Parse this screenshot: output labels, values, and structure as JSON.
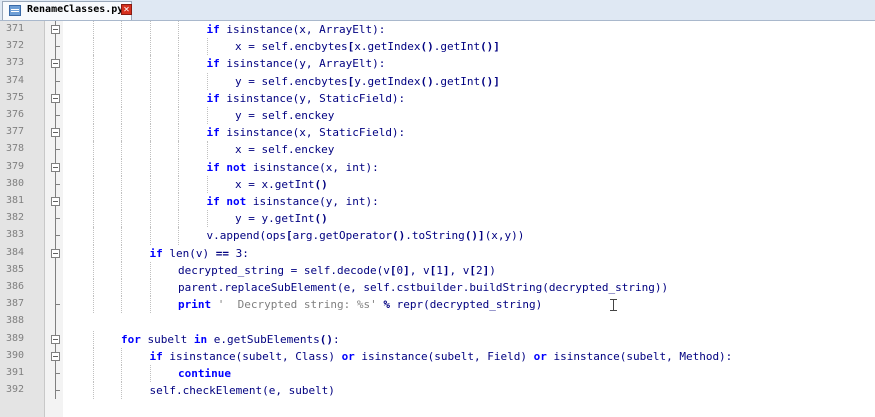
{
  "tab": {
    "title": "RenameClasses.py",
    "close_icon": "close-icon"
  },
  "lines": [
    {
      "num": "371",
      "fold": "open",
      "indent": 5,
      "code": "<k>if</k> isinstance(x, ArrayElt):"
    },
    {
      "num": "372",
      "fold": "end",
      "indent": 6,
      "code": "x = self.encbytes<b>[</b>x.getIndex<b>()</b>.getInt<b>()]</b>"
    },
    {
      "num": "373",
      "fold": "open",
      "indent": 5,
      "code": "<k>if</k> isinstance(y, ArrayElt):"
    },
    {
      "num": "374",
      "fold": "end",
      "indent": 6,
      "code": "y = self.encbytes<b>[</b>y.getIndex<b>()</b>.getInt<b>()]</b>"
    },
    {
      "num": "375",
      "fold": "open",
      "indent": 5,
      "code": "<k>if</k> isinstance(y, StaticField):"
    },
    {
      "num": "376",
      "fold": "end",
      "indent": 6,
      "code": "y = self.enckey"
    },
    {
      "num": "377",
      "fold": "open",
      "indent": 5,
      "code": "<k>if</k> isinstance(x, StaticField):"
    },
    {
      "num": "378",
      "fold": "end",
      "indent": 6,
      "code": "x = self.enckey"
    },
    {
      "num": "379",
      "fold": "open",
      "indent": 5,
      "code": "<k>if not</k> isinstance(x, int):"
    },
    {
      "num": "380",
      "fold": "end",
      "indent": 6,
      "code": "x = x.getInt<b>()</b>"
    },
    {
      "num": "381",
      "fold": "open",
      "indent": 5,
      "code": "<k>if not</k> isinstance(y, int):"
    },
    {
      "num": "382",
      "fold": "end",
      "indent": 6,
      "code": "y = y.getInt<b>()</b>"
    },
    {
      "num": "383",
      "fold": "end",
      "indent": 5,
      "code": "v.append(ops<b>[</b>arg.getOperator<b>()</b>.toString<b>()]</b>(x,y))"
    },
    {
      "num": "384",
      "fold": "open",
      "indent": 3,
      "code": "<k>if</k> len(v) <b>==</b> 3:"
    },
    {
      "num": "385",
      "fold": "line",
      "indent": 4,
      "code": "decrypted_string = self.decode(v<b>[</b>0<b>]</b>, v<b>[</b>1<b>]</b>, v<b>[</b>2<b>]</b>)"
    },
    {
      "num": "386",
      "fold": "line",
      "indent": 4,
      "code": "parent.replaceSubElement(e, self.cstbuilder.buildString(decrypted_string))"
    },
    {
      "num": "387",
      "fold": "end",
      "indent": 4,
      "code": "<k>print</k> <s>'  Decrypted string: %s'</s> <b>%</b> repr(decrypted_string)"
    },
    {
      "num": "388",
      "fold": "line",
      "indent": 0,
      "code": ""
    },
    {
      "num": "389",
      "fold": "open",
      "indent": 2,
      "code": "<k>for</k> subelt <k>in</k> e.getSubElements<b>()</b>:"
    },
    {
      "num": "390",
      "fold": "open",
      "indent": 3,
      "code": "<k>if</k> isinstance(subelt, Class) <k>or</k> isinstance(subelt, Field) <k>or</k> isinstance(subelt, Method):"
    },
    {
      "num": "391",
      "fold": "end",
      "indent": 4,
      "code": "<k>continue</k>"
    },
    {
      "num": "392",
      "fold": "end",
      "indent": 3,
      "code": "self.checkElement(e, subelt)"
    }
  ]
}
